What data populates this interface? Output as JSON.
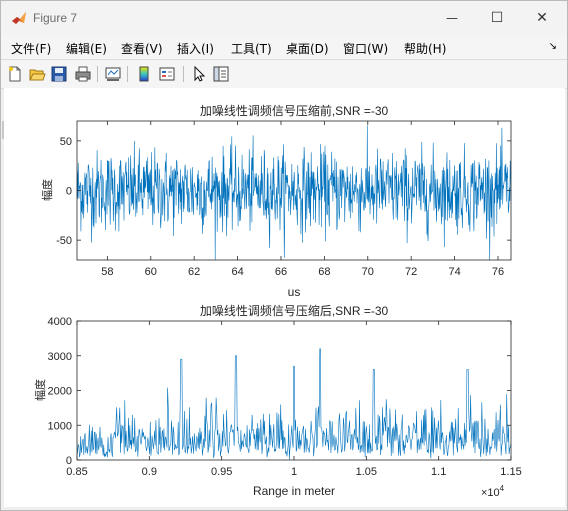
{
  "window": {
    "title": "Figure 7"
  },
  "controls": {
    "minimize": "—",
    "maximize": "☐",
    "close": "✕"
  },
  "menu": {
    "items": [
      "文件(F)",
      "编辑(E)",
      "查看(V)",
      "插入(I)",
      "工具(T)",
      "桌面(D)",
      "窗口(W)",
      "帮助(H)"
    ],
    "overflow": "↘"
  },
  "toolbar": {
    "icons": [
      "new-figure-icon",
      "open-file-icon",
      "save-icon",
      "print-icon",
      "link-plot-icon",
      "insert-colorbar-icon",
      "insert-legend-icon",
      "edit-plot-pointer-icon",
      "property-inspector-icon"
    ]
  },
  "colors": {
    "line": "#0072bd",
    "axes": "#262626",
    "grid": "none",
    "background": "#ffffff"
  },
  "chart_data": [
    {
      "type": "line",
      "title": "加噪线性调频信号压缩前,SNR =-30",
      "xlabel": "us",
      "ylabel": "幅度",
      "xlim": [
        56.6,
        76.6
      ],
      "ylim": [
        -70,
        70
      ],
      "xticks": [
        58,
        60,
        62,
        64,
        66,
        68,
        70,
        72,
        74,
        76
      ],
      "yticks": [
        -50,
        0,
        50
      ],
      "grid": false,
      "series": [
        {
          "description": "dense noise waveform",
          "y_min_approx": -70,
          "y_max_approx": 70,
          "typical_range": [
            -40,
            40
          ]
        }
      ]
    },
    {
      "type": "line",
      "title": "加噪线性调频信号压缩后,SNR =-30",
      "xlabel": "Range in meter",
      "ylabel": "幅度",
      "xlim": [
        0.85,
        1.15
      ],
      "x_exponent": "×10⁴",
      "x_exponent_base": "×10",
      "x_exponent_power": "4",
      "ylim": [
        0,
        4000
      ],
      "xticks": [
        0.85,
        0.9,
        0.95,
        1,
        1.05,
        1.1,
        1.15
      ],
      "xticklabels": [
        "0.85",
        "0.9",
        "0.95",
        "1",
        "1.05",
        "1.1",
        "1.15"
      ],
      "yticks": [
        0,
        1000,
        2000,
        3000,
        4000
      ],
      "grid": false,
      "series": [
        {
          "description": "compressed pulse noise",
          "y_min_approx": 0,
          "y_max_approx": 3200,
          "peaks": [
            {
              "x": 0.922,
              "y": 2900
            },
            {
              "x": 0.96,
              "y": 3000
            },
            {
              "x": 1.018,
              "y": 3200
            },
            {
              "x": 1.0,
              "y": 2700
            },
            {
              "x": 1.055,
              "y": 2600
            },
            {
              "x": 1.12,
              "y": 2600
            }
          ]
        }
      ]
    }
  ]
}
